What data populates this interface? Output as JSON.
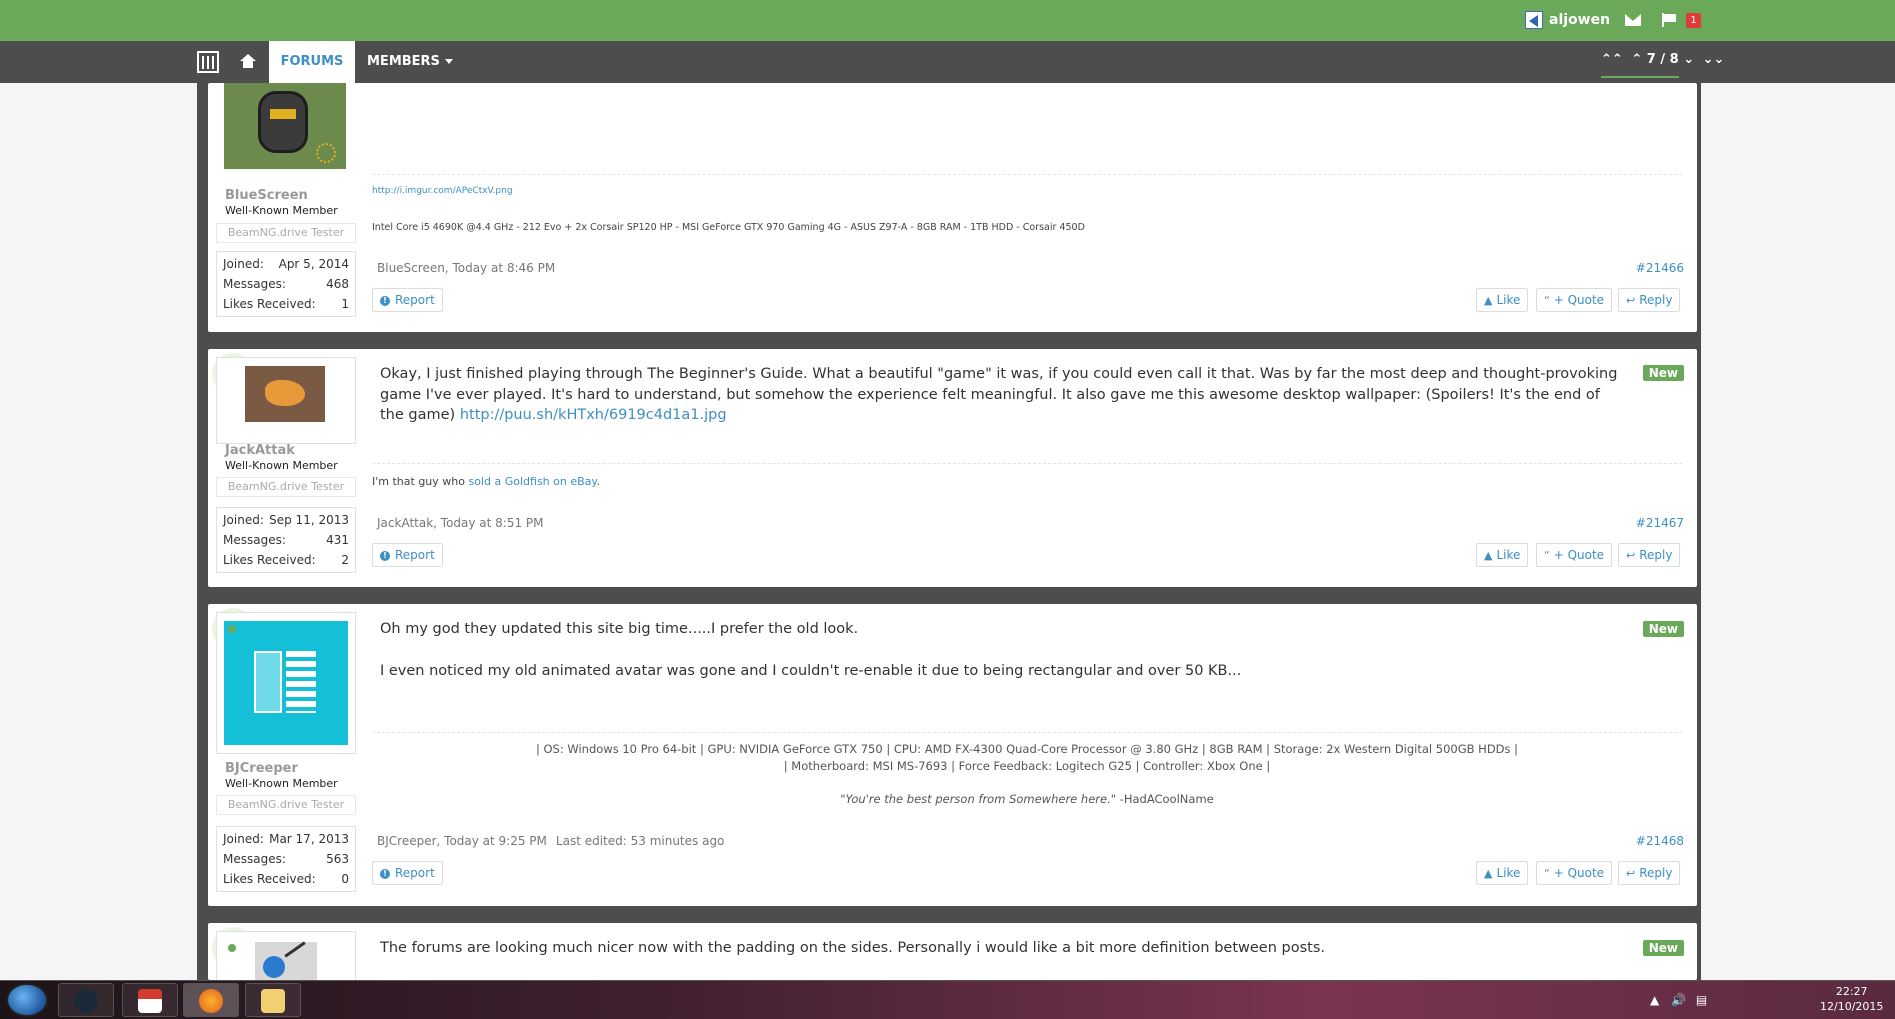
{
  "topbar": {
    "username": "aljowen",
    "alert_count": "1"
  },
  "nav": {
    "forums": "FORUMS",
    "members": "MEMBERS",
    "pager": "7 / 8"
  },
  "posts": [
    {
      "username": "BlueScreen",
      "user_title": "Well-Known Member",
      "banner": "BeamNG.drive Tester",
      "stats": {
        "joined_label": "Joined:",
        "joined": "Apr 5, 2014",
        "messages_label": "Messages:",
        "messages": "468",
        "likes_label": "Likes Received:",
        "likes": "1"
      },
      "sig_link": "http://i.imgur.com/APeCtxV.png",
      "sig_text": "Intel Core i5 4690K @4.4 GHz - 212 Evo + 2x Corsair SP120 HP - MSI GeForce GTX 970 Gaming 4G - ASUS Z97-A - 8GB RAM - 1TB HDD - Corsair 450D",
      "meta": "BlueScreen, Today at 8:46 PM",
      "post_number": "#21466"
    },
    {
      "username": "JackAttak",
      "user_title": "Well-Known Member",
      "banner": "BeamNG.drive Tester",
      "stats": {
        "joined_label": "Joined:",
        "joined": "Sep 11, 2013",
        "messages_label": "Messages:",
        "messages": "431",
        "likes_label": "Likes Received:",
        "likes": "2"
      },
      "message": "Okay, I just finished playing through The Beginner's Guide. What a beautiful \"game\" it was, if you could even call it that. Was by far the most deep and thought-provoking game I've ever played. It's hard to understand, but somehow the experience felt meaningful. It also gave me this awesome desktop wallpaper: (Spoilers! It's the end of the game) ",
      "message_link": "http://puu.sh/kHTxh/6919c4d1a1.jpg",
      "new_badge": "New",
      "sig_prefix": "I'm that guy who ",
      "sig_link": "sold a Goldfish on eBay",
      "sig_suffix": ".",
      "meta": "JackAttak, Today at 8:51 PM",
      "post_number": "#21467"
    },
    {
      "username": "BJCreeper",
      "user_title": "Well-Known Member",
      "banner": "BeamNG.drive Tester",
      "stats": {
        "joined_label": "Joined:",
        "joined": "Mar 17, 2013",
        "messages_label": "Messages:",
        "messages": "563",
        "likes_label": "Likes Received:",
        "likes": "0"
      },
      "message_line1": "Oh my god they updated this site big time.....I prefer the old look.",
      "message_line2": "I even noticed my old animated avatar was gone and I couldn't re-enable it due to being rectangular and over 50 KB...",
      "new_badge": "New",
      "sig_line1": "| OS: Windows 10 Pro 64-bit | GPU: NVIDIA GeForce GTX 750 | CPU: AMD FX-4300 Quad-Core Processor @ 3.80 GHz | 8GB RAM | Storage: 2x Western Digital 500GB HDDs |",
      "sig_line2": "| Motherboard: MSI MS-7693 | Force Feedback: Logitech G25 | Controller: Xbox One |",
      "sig_quote": "\"You're the best person from Somewhere here.\"",
      "sig_quote_author": " -HadACoolName",
      "meta": "BJCreeper, Today at 9:25 PM",
      "meta_edited": "Last edited: 53 minutes ago",
      "post_number": "#21468"
    },
    {
      "message": "The forums are looking much nicer now with the padding on the sides. Personally i would like a bit more definition between posts.",
      "new_badge": "New"
    }
  ],
  "actions": {
    "report": "Report",
    "like": "Like",
    "quote": "+ Quote",
    "reply": "Reply"
  },
  "taskbar": {
    "time": "22:27",
    "date": "12/10/2015"
  },
  "colors": {
    "topbar": "#6aa95a",
    "navbar": "#4d4d4d",
    "link": "#3d8fc4",
    "new_badge": "#6aa95a"
  }
}
